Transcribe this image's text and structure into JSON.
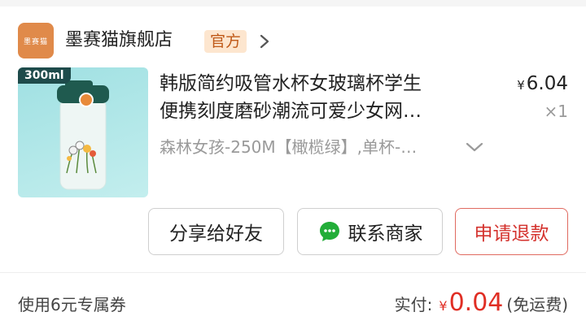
{
  "shop": {
    "logo_text": "墨赛猫",
    "name": "墨赛猫旗舰店",
    "badge": "官方"
  },
  "product": {
    "image_tag": "300ml",
    "title_line1": "韩版简约吸管水杯女玻璃杯学生",
    "title_line2": "便携刻度磨砂潮流可爱少女网…",
    "price_symbol": "¥",
    "price": "6.04",
    "quantity": "×1",
    "variant": "森林女孩-250M【橄榄绿】,单杯-…"
  },
  "actions": {
    "share": "分享给好友",
    "contact": "联系商家",
    "refund": "申请退款"
  },
  "footer": {
    "coupon": "使用6元专属券",
    "paid_label": "实付:",
    "paid_symbol": "¥",
    "paid_amount": "0.04",
    "paid_note": "(免运费)"
  },
  "colors": {
    "accent_red": "#e02e24",
    "badge_bg": "#fde6cf",
    "badge_text": "#c05a19",
    "chat_green": "#22ad38"
  },
  "icons": [
    "chevron-right-icon",
    "chevron-down-icon",
    "chat-bubble-icon"
  ]
}
